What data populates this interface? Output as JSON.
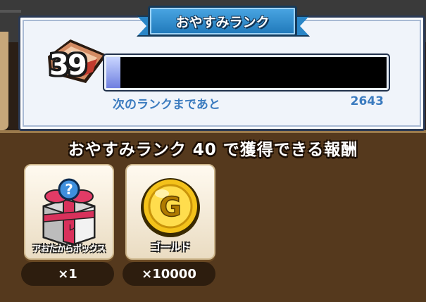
{
  "rank_panel": {
    "title": "おやすみランク",
    "current_rank": "39",
    "progress_fraction": 0.05,
    "next_label": "次のランクまであと",
    "next_value": "2643"
  },
  "rewards": {
    "heading": "おやすみランク 40 で獲得できる報酬",
    "items": [
      {
        "name": "アおたからボックス",
        "quantity": "×1",
        "icon": "gift-box-icon"
      },
      {
        "name": "ゴールド",
        "quantity": "×10000",
        "icon": "gold-coin-icon"
      }
    ]
  },
  "colors": {
    "ribbon": "#2a86c7",
    "text_accent": "#3b7bbf",
    "panel_brown": "#55391d"
  }
}
